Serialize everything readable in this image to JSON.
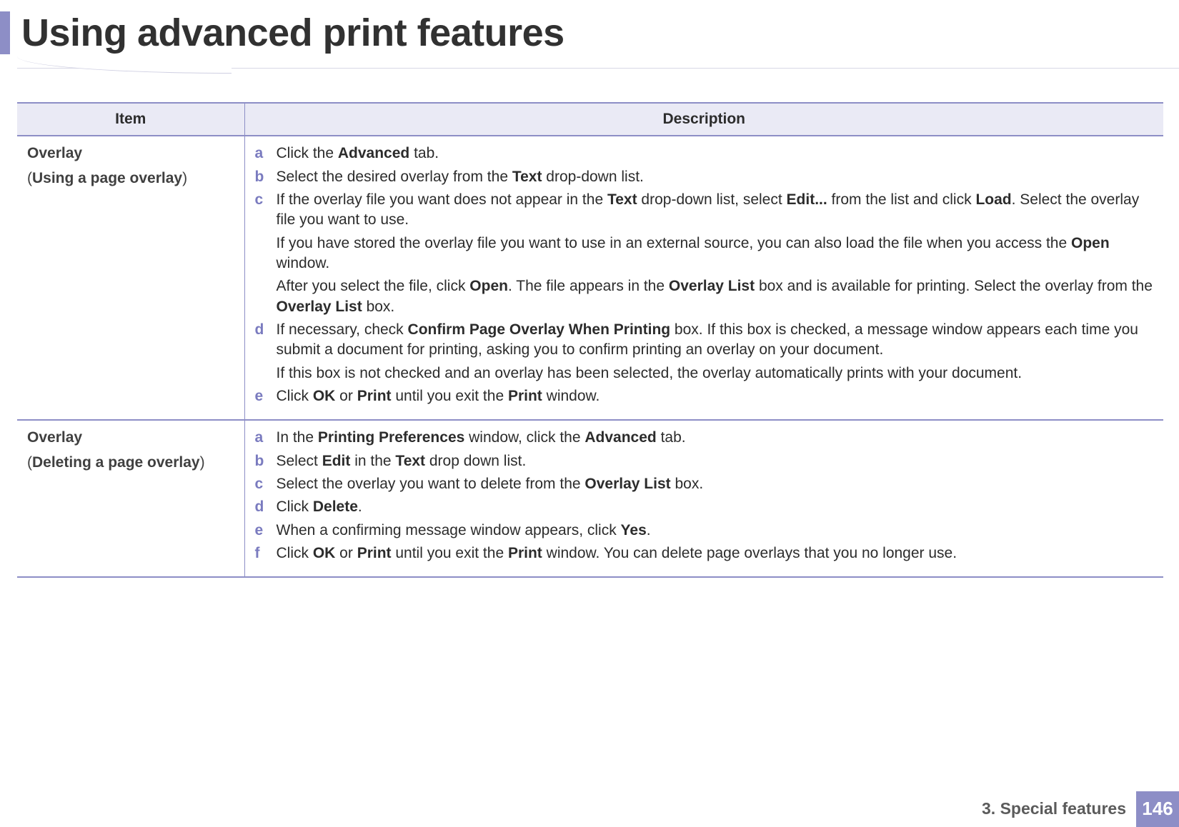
{
  "title": "Using advanced print features",
  "table": {
    "headers": {
      "item": "Item",
      "description": "Description"
    },
    "rows": [
      {
        "item_title": "Overlay",
        "item_sub_prefix": "(",
        "item_sub_bold": "Using a page overlay",
        "item_sub_suffix": ")",
        "steps": [
          {
            "marker": "a",
            "html": "Click the <b>Advanced</b> tab."
          },
          {
            "marker": "b",
            "html": "Select the desired overlay from the <b>Text</b> drop-down list."
          },
          {
            "marker": "c",
            "html": "If the overlay file you want does not appear in the <b>Text</b> drop-down list, select <b>Edit...</b> from the list and click <b>Load</b>. Select the overlay file you want to use.",
            "extras": [
              "If you have stored the overlay file you want to use in an external source, you can also load the file when you access the <b>Open</b> window.",
              "After you select the file, click <b>Open</b>. The file appears in the <b>Overlay List</b> box and is available for printing. Select the overlay from the <b>Overlay List</b> box."
            ]
          },
          {
            "marker": "d",
            "html": "If necessary, check <b>Confirm Page Overlay When Printing</b> box. If this box is checked, a message window appears each time you submit a document for printing, asking you to confirm printing an overlay on your document.",
            "extras": [
              "If this box is not checked and an overlay has been selected, the overlay automatically prints with your document."
            ]
          },
          {
            "marker": "e",
            "html": "Click <b>OK</b> or <b>Print</b> until you exit the <b>Print</b> window."
          }
        ]
      },
      {
        "item_title": "Overlay",
        "item_sub_prefix": "(",
        "item_sub_bold": "Deleting a page overlay",
        "item_sub_suffix": ")",
        "steps": [
          {
            "marker": "a",
            "html": "In the <b>Printing Preferences</b> window, click the <b>Advanced</b> tab."
          },
          {
            "marker": "b",
            "html": "Select <b>Edit</b> in the <b>Text</b> drop down list."
          },
          {
            "marker": "c",
            "html": "Select the overlay you want to delete from the <b>Overlay List</b> box."
          },
          {
            "marker": "d",
            "html": "Click <b>Delete</b>."
          },
          {
            "marker": "e",
            "html": "When a confirming message window appears, click <b>Yes</b>."
          },
          {
            "marker": "f",
            "html": "Click <b>OK</b> or <b>Print</b> until you exit the <b>Print</b> window. You can delete page overlays that you no longer use."
          }
        ]
      }
    ]
  },
  "footer": {
    "chapter": "3.  Special features",
    "page": "146"
  }
}
